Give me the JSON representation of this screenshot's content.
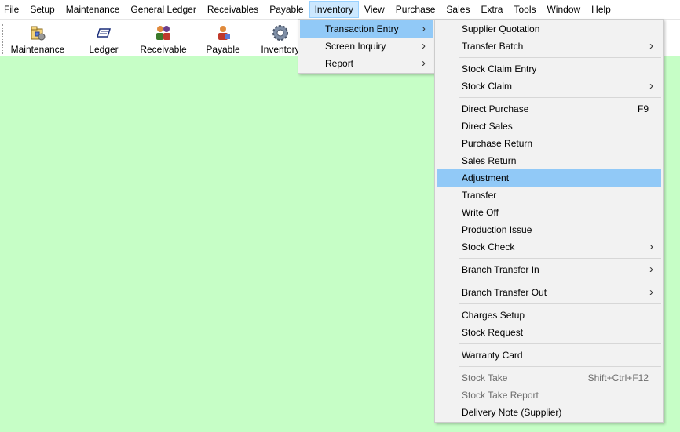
{
  "menubar": {
    "items": [
      "File",
      "Setup",
      "Maintenance",
      "General Ledger",
      "Receivables",
      "Payable",
      "Inventory",
      "View",
      "Purchase",
      "Sales",
      "Extra",
      "Tools",
      "Window",
      "Help"
    ],
    "open_index": 6
  },
  "toolbar": {
    "buttons": [
      {
        "label": "Maintenance",
        "icon": "maintenance-icon"
      },
      {
        "label": "Ledger",
        "icon": "ledger-icon"
      },
      {
        "label": "Receivable",
        "icon": "receivable-icon"
      },
      {
        "label": "Payable",
        "icon": "payable-icon"
      },
      {
        "label": "Inventory",
        "icon": "gear-icon"
      }
    ]
  },
  "inventory_menu": {
    "items": [
      {
        "label": "Transaction Entry",
        "submenu": true,
        "highlighted": true
      },
      {
        "label": "Screen Inquiry",
        "submenu": true
      },
      {
        "label": "Report",
        "submenu": true
      }
    ]
  },
  "transaction_menu": {
    "items": [
      {
        "label": "Supplier Quotation"
      },
      {
        "label": "Transfer Batch",
        "submenu": true
      },
      {
        "separator": true
      },
      {
        "label": "Stock Claim Entry"
      },
      {
        "label": "Stock Claim",
        "submenu": true
      },
      {
        "separator": true
      },
      {
        "label": "Direct Purchase",
        "shortcut": "F9"
      },
      {
        "label": "Direct Sales"
      },
      {
        "label": "Purchase Return"
      },
      {
        "label": "Sales Return"
      },
      {
        "label": "Adjustment",
        "highlighted": true
      },
      {
        "label": "Transfer"
      },
      {
        "label": "Write Off"
      },
      {
        "label": "Production Issue"
      },
      {
        "label": "Stock Check",
        "submenu": true
      },
      {
        "separator": true
      },
      {
        "label": "Branch Transfer In",
        "submenu": true
      },
      {
        "separator": true
      },
      {
        "label": "Branch Transfer Out",
        "submenu": true
      },
      {
        "separator": true
      },
      {
        "label": "Charges Setup"
      },
      {
        "label": "Stock Request"
      },
      {
        "separator": true
      },
      {
        "label": "Warranty Card"
      },
      {
        "separator": true
      },
      {
        "label": "Stock Take",
        "shortcut": "Shift+Ctrl+F12",
        "disabled": true
      },
      {
        "label": "Stock Take Report",
        "disabled": true
      },
      {
        "label": "Delivery Note (Supplier)"
      }
    ]
  },
  "colors": {
    "workspace": "#c6fec6",
    "menu_highlight": "#91c9f7",
    "menubar_open": "#cce8ff"
  }
}
